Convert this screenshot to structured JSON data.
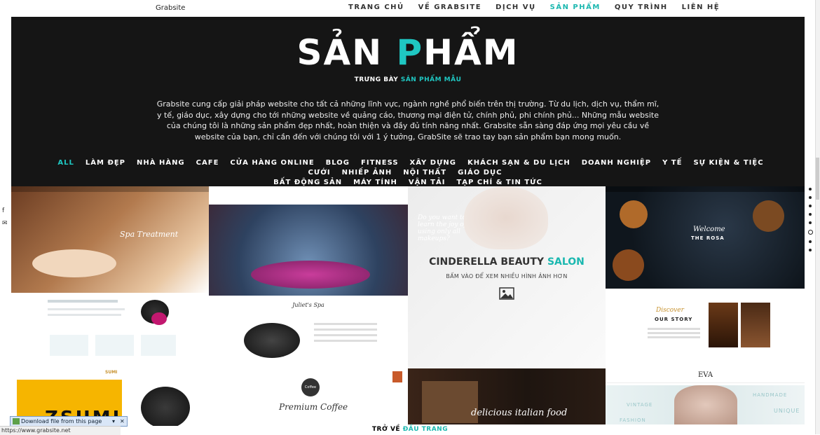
{
  "header": {
    "brand": "Grabsite",
    "nav": [
      "TRANG CHỦ",
      "VỀ GRABSITE",
      "DỊCH VỤ",
      "SẢN PHẨM",
      "QUY TRÌNH",
      "LIÊN HỆ"
    ],
    "nav_active_index": 3
  },
  "hero": {
    "title_pre": "SẢN ",
    "title_accent": "P",
    "title_post": "HẨM",
    "subtitle_pre": "TRƯNG BÀY ",
    "subtitle_accent": "SẢN PHẨM MẪU",
    "description": "Grabsite cung cấp giải pháp website cho tất cả những lĩnh vực, ngành nghề phổ biến trên thị trường. Từ du lịch, dịch vụ, thẩm mĩ, y tế, giáo dục, xây dựng cho tới những website về quảng cáo, thương mại điện tử, chính phủ, phi chính phủ... Những mẫu website của chúng tôi là những sản phẩm đẹp nhất, hoàn thiện và đầy đủ tính năng nhất. Grabsite sẵn sàng đáp ứng mọi yêu cầu về website của bạn, chỉ cần đến với chúng tôi với 1 ý tưởng, GrabSite sẽ trao tay bạn sản phẩm bạn mong muốn."
  },
  "filters": {
    "row1": [
      "ALL",
      "LÀM ĐẸP",
      "NHÀ HÀNG",
      "CAFE",
      "CỬA HÀNG ONLINE",
      "BLOG",
      "FITNESS",
      "XÂY DỰNG",
      "KHÁCH SẠN & DU LỊCH",
      "DOANH NGHIỆP",
      "Y TẾ",
      "SỰ KIỆN & TIỆC CƯỚI",
      "NHIẾP ẢNH",
      "NỘI THẤT",
      "GIÁO DỤC"
    ],
    "row2": [
      "BẤT ĐỘNG SẢN",
      "MÁY TÍNH",
      "VẬN TẢI",
      "TẠP CHÍ & TIN TỨC"
    ],
    "active": "ALL"
  },
  "gallery": {
    "spa_heading": "Spa Treatment",
    "juliet_heading": "Juliet's Spa",
    "cinderella_title_pre": "CINDERELLA BEAUTY ",
    "cinderella_title_accent": "SALON",
    "cinderella_subtitle": "BẤM VÀO ĐỂ XEM NHIỀU HÌNH ẢNH HƠN",
    "cinderella_tagline": "Do you want to learn the joy of using only all makeups?",
    "rosa_welcome": "Welcome",
    "rosa_name": "THE ROSA",
    "rosa_discover": "Discover",
    "rosa_our_story": "OUR STORY",
    "sumi_logo": "SUMI",
    "sumi_big": "ZSUMI",
    "coffee_badge": "Coffee",
    "coffee_script": "Premium Coffee",
    "italian_script": "delicious italian food",
    "eva_logo": "EVA",
    "eva_words": [
      "VINTAGE",
      "HANDMADE",
      "FASHION",
      "UNIQUE"
    ]
  },
  "back_to_top_pre": "TRỞ VỀ ",
  "back_to_top_accent": "ĐẦU TRANG",
  "browser": {
    "status_url": "https://www.grabsite.net",
    "download_bar": "Download file from this page"
  },
  "colors": {
    "accent": "#1fc7c2",
    "hero_bg": "#151515"
  }
}
